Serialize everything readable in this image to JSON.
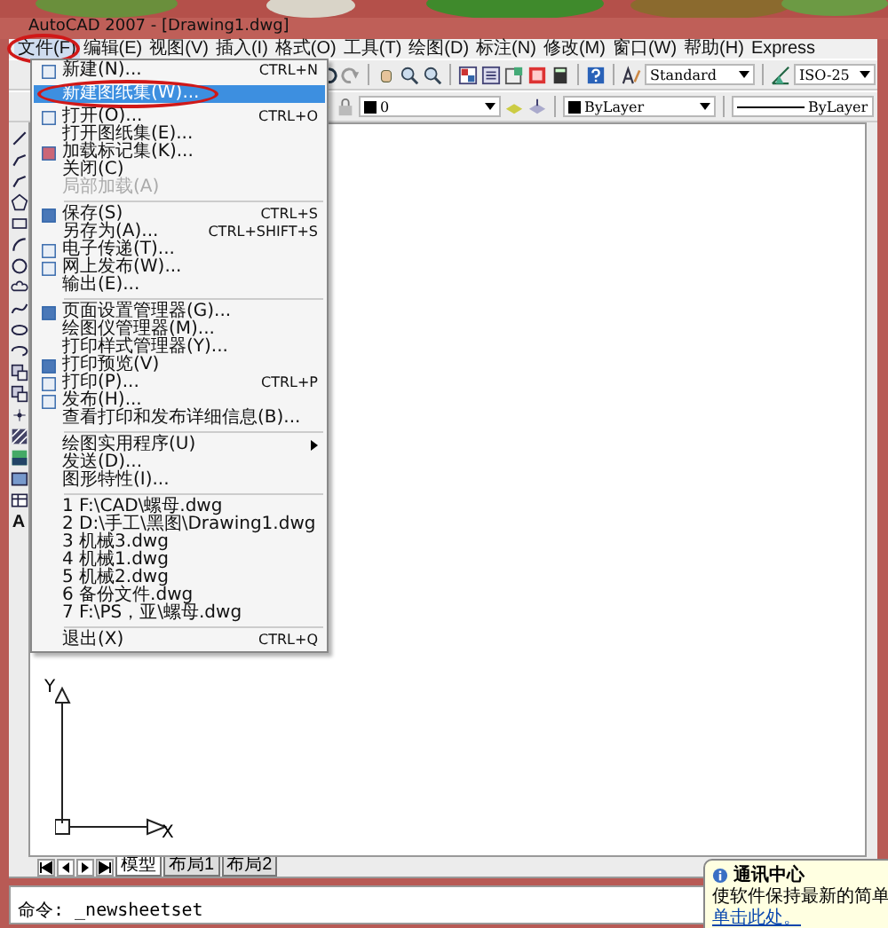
{
  "window": {
    "title": "AutoCAD 2007 - [Drawing1.dwg]"
  },
  "menubar": [
    {
      "label": "文件(F)",
      "selected": true
    },
    {
      "label": "编辑(E)",
      "selected": false
    },
    {
      "label": "视图(V)",
      "selected": false
    },
    {
      "label": "插入(I)",
      "selected": false
    },
    {
      "label": "格式(O)",
      "selected": false
    },
    {
      "label": "工具(T)",
      "selected": false
    },
    {
      "label": "绘图(D)",
      "selected": false
    },
    {
      "label": "标注(N)",
      "selected": false
    },
    {
      "label": "修改(M)",
      "selected": false
    },
    {
      "label": "窗口(W)",
      "selected": false
    },
    {
      "label": "帮助(H)",
      "selected": false
    },
    {
      "label": "Express",
      "selected": false
    }
  ],
  "toolbar": {
    "text_style": "Standard",
    "dim_style": "ISO-25",
    "layer": "0",
    "color_setting": "ByLayer",
    "linetype": "ByLayer"
  },
  "file_menu": [
    {
      "kind": "item",
      "label": "新建(N)...",
      "shortcut": "CTRL+N",
      "selected": false,
      "disabled": false
    },
    {
      "kind": "item",
      "label": "新建图纸集(W)...",
      "selected": true,
      "disabled": false
    },
    {
      "kind": "item",
      "label": "打开(O)...",
      "shortcut": "CTRL+O",
      "selected": false,
      "disabled": false
    },
    {
      "kind": "item",
      "label": "打开图纸集(E)...",
      "selected": false,
      "disabled": false
    },
    {
      "kind": "item",
      "label": "加载标记集(K)...",
      "selected": false,
      "disabled": false
    },
    {
      "kind": "item",
      "label": "关闭(C)",
      "selected": false,
      "disabled": false
    },
    {
      "kind": "item",
      "label": "局部加载(A)",
      "selected": false,
      "disabled": true
    },
    {
      "kind": "separator"
    },
    {
      "kind": "item",
      "label": "保存(S)",
      "shortcut": "CTRL+S",
      "selected": false,
      "disabled": false
    },
    {
      "kind": "item",
      "label": "另存为(A)...",
      "shortcut": "CTRL+SHIFT+S",
      "selected": false,
      "disabled": false
    },
    {
      "kind": "item",
      "label": "电子传递(T)...",
      "selected": false,
      "disabled": false
    },
    {
      "kind": "item",
      "label": "网上发布(W)...",
      "selected": false,
      "disabled": false
    },
    {
      "kind": "item",
      "label": "输出(E)...",
      "selected": false,
      "disabled": false
    },
    {
      "kind": "separator"
    },
    {
      "kind": "item",
      "label": "页面设置管理器(G)...",
      "selected": false,
      "disabled": false
    },
    {
      "kind": "item",
      "label": "绘图仪管理器(M)...",
      "selected": false,
      "disabled": false
    },
    {
      "kind": "item",
      "label": "打印样式管理器(Y)...",
      "selected": false,
      "disabled": false
    },
    {
      "kind": "item",
      "label": "打印预览(V)",
      "selected": false,
      "disabled": false
    },
    {
      "kind": "item",
      "label": "打印(P)...",
      "shortcut": "CTRL+P",
      "selected": false,
      "disabled": false
    },
    {
      "kind": "item",
      "label": "发布(H)...",
      "selected": false,
      "disabled": false
    },
    {
      "kind": "item",
      "label": "查看打印和发布详细信息(B)...",
      "selected": false,
      "disabled": false
    },
    {
      "kind": "separator"
    },
    {
      "kind": "submenu",
      "label": "绘图实用程序(U)",
      "selected": false,
      "disabled": false
    },
    {
      "kind": "item",
      "label": "发送(D)...",
      "selected": false,
      "disabled": false
    },
    {
      "kind": "item",
      "label": "图形特性(I)...",
      "selected": false,
      "disabled": false
    },
    {
      "kind": "separator"
    },
    {
      "kind": "item",
      "label": "1 F:\\CAD\\螺母.dwg",
      "selected": false,
      "disabled": false
    },
    {
      "kind": "item",
      "label": "2 D:\\手工\\黑图\\Drawing1.dwg",
      "selected": false,
      "disabled": false
    },
    {
      "kind": "item",
      "label": "3 机械3.dwg",
      "selected": false,
      "disabled": false
    },
    {
      "kind": "item",
      "label": "4 机械1.dwg",
      "selected": false,
      "disabled": false
    },
    {
      "kind": "item",
      "label": "5 机械2.dwg",
      "selected": false,
      "disabled": false
    },
    {
      "kind": "item",
      "label": "6 备份文件.dwg",
      "selected": false,
      "disabled": false
    },
    {
      "kind": "item",
      "label": "7 F:\\PS，亚\\螺母.dwg",
      "selected": false,
      "disabled": false
    },
    {
      "kind": "separator"
    },
    {
      "kind": "item",
      "label": "退出(X)",
      "shortcut": "CTRL+Q",
      "selected": false,
      "disabled": false
    }
  ],
  "draw_toolbar": {
    "text_tool": "A"
  },
  "ucs": {
    "y": "Y",
    "x": "X"
  },
  "layout_tabs": [
    {
      "label": "模型",
      "selected": true
    },
    {
      "label": "布局1",
      "selected": false
    },
    {
      "label": "布局2",
      "selected": false
    }
  ],
  "command_line": "命令: _newsheetset",
  "balloon": {
    "title": "通讯中心",
    "text": "使软件保持最新的简单",
    "link": "单击此处。"
  }
}
